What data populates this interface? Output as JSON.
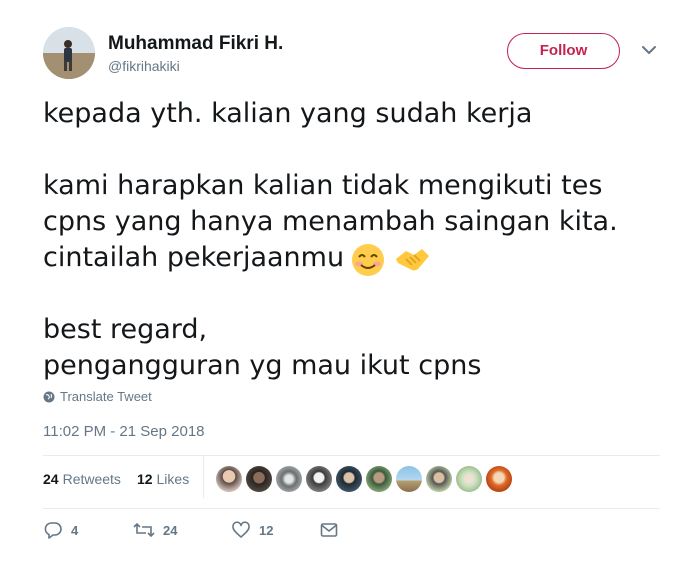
{
  "header": {
    "display_name": "Muhammad Fikri H.",
    "handle": "@fikrihakiki",
    "follow_label": "Follow"
  },
  "tweet": {
    "lines": [
      "kepada yth. kalian yang sudah kerja",
      "",
      "kami harapkan kalian tidak mengikuti tes",
      "cpns yang hanya menambah saingan kita.",
      "cintailah pekerjaanmu",
      "",
      "best regard,",
      "pengangguran yg mau ikut cpns"
    ],
    "emojis": [
      "smiling-face-emoji",
      "handshake-emoji"
    ]
  },
  "translate_label": "Translate Tweet",
  "timestamp": "11:02 PM - 21 Sep 2018",
  "stats": {
    "retweets_count": "24",
    "retweets_label": "Retweets",
    "likes_count": "12",
    "likes_label": "Likes"
  },
  "likers_count": 10,
  "actions": {
    "replies": "4",
    "retweets": "24",
    "likes": "12"
  },
  "colors": {
    "accent": "#c5234f",
    "text": "#14171a",
    "muted": "#657786",
    "divider": "#e6ecf0"
  }
}
